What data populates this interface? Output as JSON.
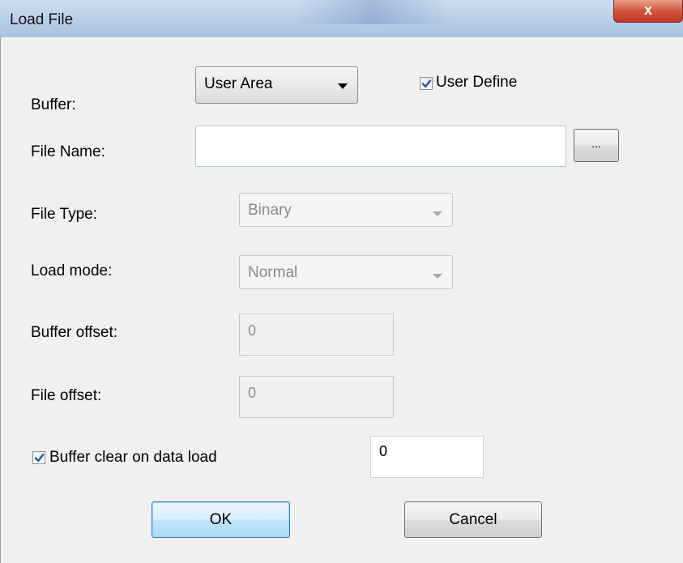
{
  "window": {
    "title": "Load File",
    "close_glyph": "x"
  },
  "buffer": {
    "label": "Buffer:",
    "selected": "User Area"
  },
  "user_define": {
    "label": "User Define",
    "checked": true
  },
  "file_name": {
    "label": "File Name:",
    "value": "",
    "browse_label": "..."
  },
  "file_type": {
    "label": "File Type:",
    "selected": "Binary"
  },
  "load_mode": {
    "label": "Load mode:",
    "selected": "Normal"
  },
  "buffer_offset": {
    "label": "Buffer offset:",
    "value": "0"
  },
  "file_offset": {
    "label": "File offset:",
    "value": "0"
  },
  "buffer_clear": {
    "label": "Buffer clear on data load",
    "checked": true,
    "value": "0"
  },
  "buttons": {
    "ok": "OK",
    "cancel": "Cancel"
  },
  "colors": {
    "titlebar": "#bcd1ea",
    "close": "#c0392b",
    "default_button": "#3c7fb1",
    "check": "#2a4fa6"
  }
}
